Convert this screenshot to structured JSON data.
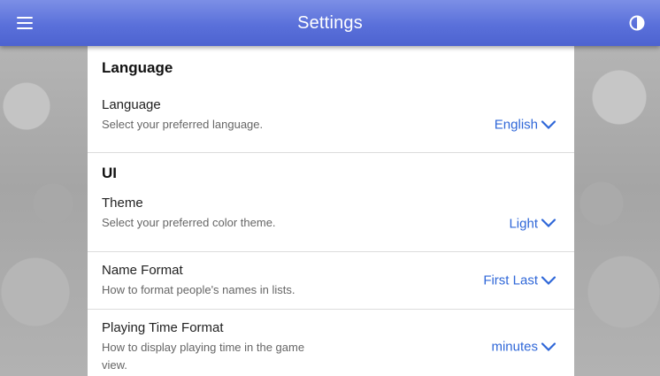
{
  "appbar": {
    "title": "Settings",
    "menu_icon": "hamburger-menu-icon",
    "theme_icon": "contrast-half-circle-icon",
    "color": "#5a70da"
  },
  "sections": {
    "language": {
      "title": "Language",
      "rows": [
        {
          "label": "Language",
          "description": "Select your preferred language.",
          "value": "English"
        }
      ]
    },
    "ui": {
      "title": "UI",
      "rows": [
        {
          "label": "Theme",
          "description": "Select your preferred color theme.",
          "value": "Light"
        },
        {
          "label": "Name Format",
          "description": "How to format people's names in lists.",
          "value": "First Last"
        },
        {
          "label": "Playing Time Format",
          "description": "How to display playing time in the game view.",
          "value": "minutes"
        }
      ]
    }
  },
  "colors": {
    "accent": "#2f67d8",
    "divider": "#dcdcdc"
  }
}
